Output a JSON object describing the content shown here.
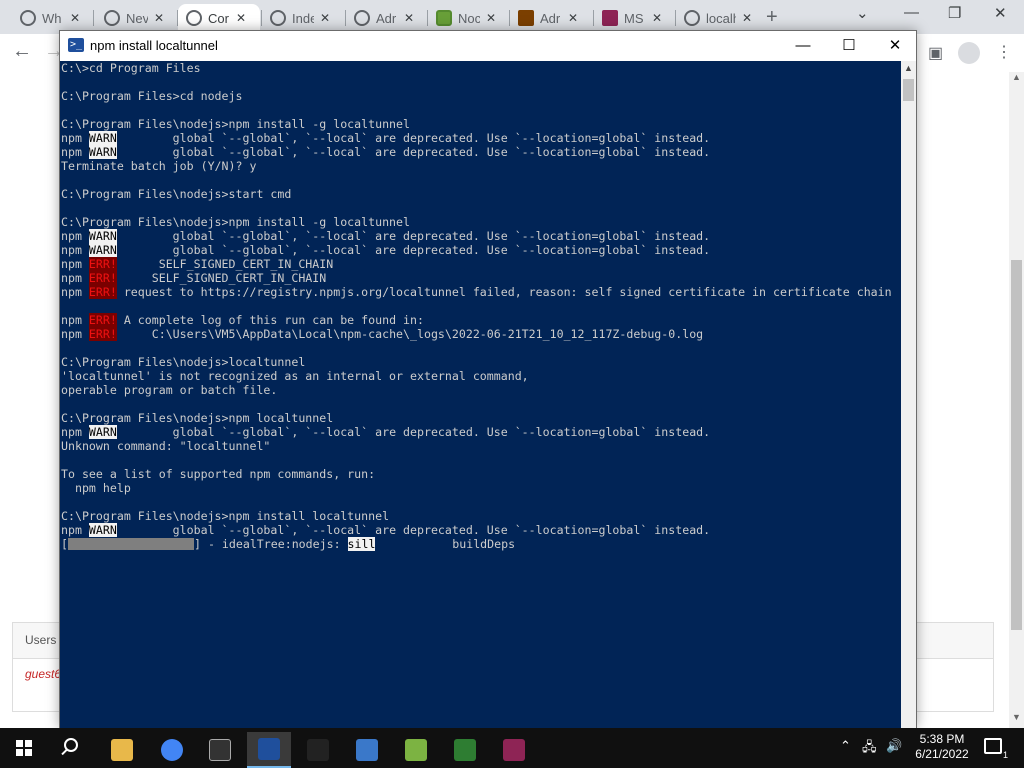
{
  "browser": {
    "tabs": [
      {
        "label": "Wh",
        "icon": "chrome-icon"
      },
      {
        "label": "Nev",
        "icon": "chrome-icon"
      },
      {
        "label": "Cor",
        "icon": "chrome-icon",
        "active": true
      },
      {
        "label": "Inde",
        "icon": "github-icon"
      },
      {
        "label": "Adr",
        "icon": "chrome-icon"
      },
      {
        "label": "Noc",
        "icon": "nodejs-icon"
      },
      {
        "label": "Adr",
        "icon": "hfs-icon"
      },
      {
        "label": "MS",
        "icon": "msys-icon"
      },
      {
        "label": "localho",
        "icon": "chrome-icon"
      }
    ],
    "new_tab": "+",
    "page": {
      "card_title": "Users C",
      "guest_text": "guest6"
    }
  },
  "console": {
    "title": "npm install localtunnel",
    "lines": [
      [
        {
          "t": "C:\\>cd Program Files"
        }
      ],
      [
        {
          "t": ""
        }
      ],
      [
        {
          "t": "C:\\Program Files>cd nodejs"
        }
      ],
      [
        {
          "t": ""
        }
      ],
      [
        {
          "t": "C:\\Program Files\\nodejs>npm install -g localtunnel"
        }
      ],
      [
        {
          "t": "npm "
        },
        {
          "t": "WARN",
          "c": "warn"
        },
        {
          "t": "        global `--global`, `--local` are deprecated. Use `--location=global` instead."
        }
      ],
      [
        {
          "t": "npm "
        },
        {
          "t": "WARN",
          "c": "warn"
        },
        {
          "t": "        global `--global`, `--local` are deprecated. Use `--location=global` instead."
        }
      ],
      [
        {
          "t": "Terminate batch job (Y/N)? y"
        }
      ],
      [
        {
          "t": ""
        }
      ],
      [
        {
          "t": "C:\\Program Files\\nodejs>start cmd"
        }
      ],
      [
        {
          "t": ""
        }
      ],
      [
        {
          "t": "C:\\Program Files\\nodejs>npm install -g localtunnel"
        }
      ],
      [
        {
          "t": "npm "
        },
        {
          "t": "WARN",
          "c": "warn"
        },
        {
          "t": "        global `--global`, `--local` are deprecated. Use `--location=global` instead."
        }
      ],
      [
        {
          "t": "npm "
        },
        {
          "t": "WARN",
          "c": "warn"
        },
        {
          "t": "        global `--global`, `--local` are deprecated. Use `--location=global` instead."
        }
      ],
      [
        {
          "t": "npm "
        },
        {
          "t": "ERR!",
          "c": "err"
        },
        {
          "t": "      SELF_SIGNED_CERT_IN_CHAIN"
        }
      ],
      [
        {
          "t": "npm "
        },
        {
          "t": "ERR!",
          "c": "err"
        },
        {
          "t": "     SELF_SIGNED_CERT_IN_CHAIN"
        }
      ],
      [
        {
          "t": "npm "
        },
        {
          "t": "ERR!",
          "c": "err"
        },
        {
          "t": " request to https://registry.npmjs.org/localtunnel failed, reason: self signed certificate in certificate chain"
        }
      ],
      [
        {
          "t": ""
        }
      ],
      [
        {
          "t": "npm "
        },
        {
          "t": "ERR!",
          "c": "err"
        },
        {
          "t": " A complete log of this run can be found in:"
        }
      ],
      [
        {
          "t": "npm "
        },
        {
          "t": "ERR!",
          "c": "err"
        },
        {
          "t": "     C:\\Users\\VM5\\AppData\\Local\\npm-cache\\_logs\\2022-06-21T21_10_12_117Z-debug-0.log"
        }
      ],
      [
        {
          "t": ""
        }
      ],
      [
        {
          "t": "C:\\Program Files\\nodejs>localtunnel"
        }
      ],
      [
        {
          "t": "'localtunnel' is not recognized as an internal or external command,"
        }
      ],
      [
        {
          "t": "operable program or batch file."
        }
      ],
      [
        {
          "t": ""
        }
      ],
      [
        {
          "t": "C:\\Program Files\\nodejs>npm localtunnel"
        }
      ],
      [
        {
          "t": "npm "
        },
        {
          "t": "WARN",
          "c": "warn"
        },
        {
          "t": "        global `--global`, `--local` are deprecated. Use `--location=global` instead."
        }
      ],
      [
        {
          "t": "Unknown command: \"localtunnel\""
        }
      ],
      [
        {
          "t": ""
        }
      ],
      [
        {
          "t": "To see a list of supported npm commands, run:"
        }
      ],
      [
        {
          "t": "  npm help"
        }
      ],
      [
        {
          "t": ""
        }
      ],
      [
        {
          "t": "C:\\Program Files\\nodejs>npm install localtunnel"
        }
      ],
      [
        {
          "t": "npm "
        },
        {
          "t": "WARN",
          "c": "warn"
        },
        {
          "t": "        global `--global`, `--local` are deprecated. Use `--location=global` instead."
        }
      ],
      [
        {
          "t": "["
        },
        {
          "t": "",
          "c": "prog"
        },
        {
          "t": "] - idealTree:nodejs: "
        },
        {
          "t": "sill",
          "c": "sill"
        },
        {
          "t": "           buildDeps"
        }
      ]
    ]
  },
  "taskbar": {
    "apps": [
      "file-explorer-icon",
      "chrome-icon",
      "7zip-icon",
      "powershell-icon",
      "cmd-icon",
      "network-tool-icon",
      "notepad-plus-icon",
      "spreadsheet-icon",
      "msys-icon"
    ],
    "time": "5:38 PM",
    "date": "6/21/2022",
    "notification_count": "1"
  }
}
